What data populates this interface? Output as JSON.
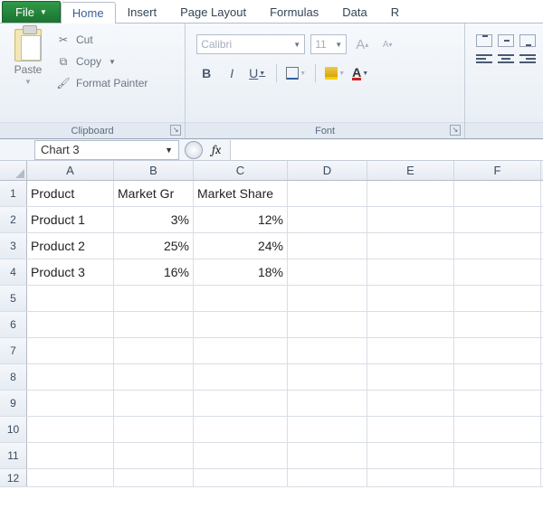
{
  "tabs": {
    "file": "File",
    "items": [
      "Home",
      "Insert",
      "Page Layout",
      "Formulas",
      "Data",
      "R"
    ],
    "active_index": 0
  },
  "ribbon": {
    "clipboard": {
      "title": "Clipboard",
      "paste": "Paste",
      "cut": "Cut",
      "copy": "Copy",
      "format_painter": "Format Painter"
    },
    "font": {
      "title": "Font",
      "name": "Calibri",
      "size": "11",
      "bold": "B",
      "italic": "I",
      "underline": "U",
      "font_color_letter": "A"
    }
  },
  "namebox": "Chart 3",
  "fx_label": "fx",
  "formula_value": "",
  "grid": {
    "columns": [
      "A",
      "B",
      "C",
      "D",
      "E",
      "F"
    ],
    "row_headers": [
      "1",
      "2",
      "3",
      "4",
      "5",
      "6",
      "7",
      "8",
      "9",
      "10",
      "11",
      "12"
    ],
    "cells": {
      "A1": "Product",
      "B1": "Market Gr",
      "C1": "Market Share",
      "A2": "Product 1",
      "B2": "3%",
      "C2": "12%",
      "A3": "Product 2",
      "B3": "25%",
      "C3": "24%",
      "A4": "Product 3",
      "B4": "16%",
      "C4": "18%"
    }
  },
  "chart_data": {
    "type": "table",
    "title": "",
    "columns": [
      "Product",
      "Market Growth",
      "Market Share"
    ],
    "rows": [
      {
        "Product": "Product 1",
        "Market Growth": 0.03,
        "Market Share": 0.12
      },
      {
        "Product": "Product 2",
        "Market Growth": 0.25,
        "Market Share": 0.24
      },
      {
        "Product": "Product 3",
        "Market Growth": 0.16,
        "Market Share": 0.18
      }
    ]
  }
}
